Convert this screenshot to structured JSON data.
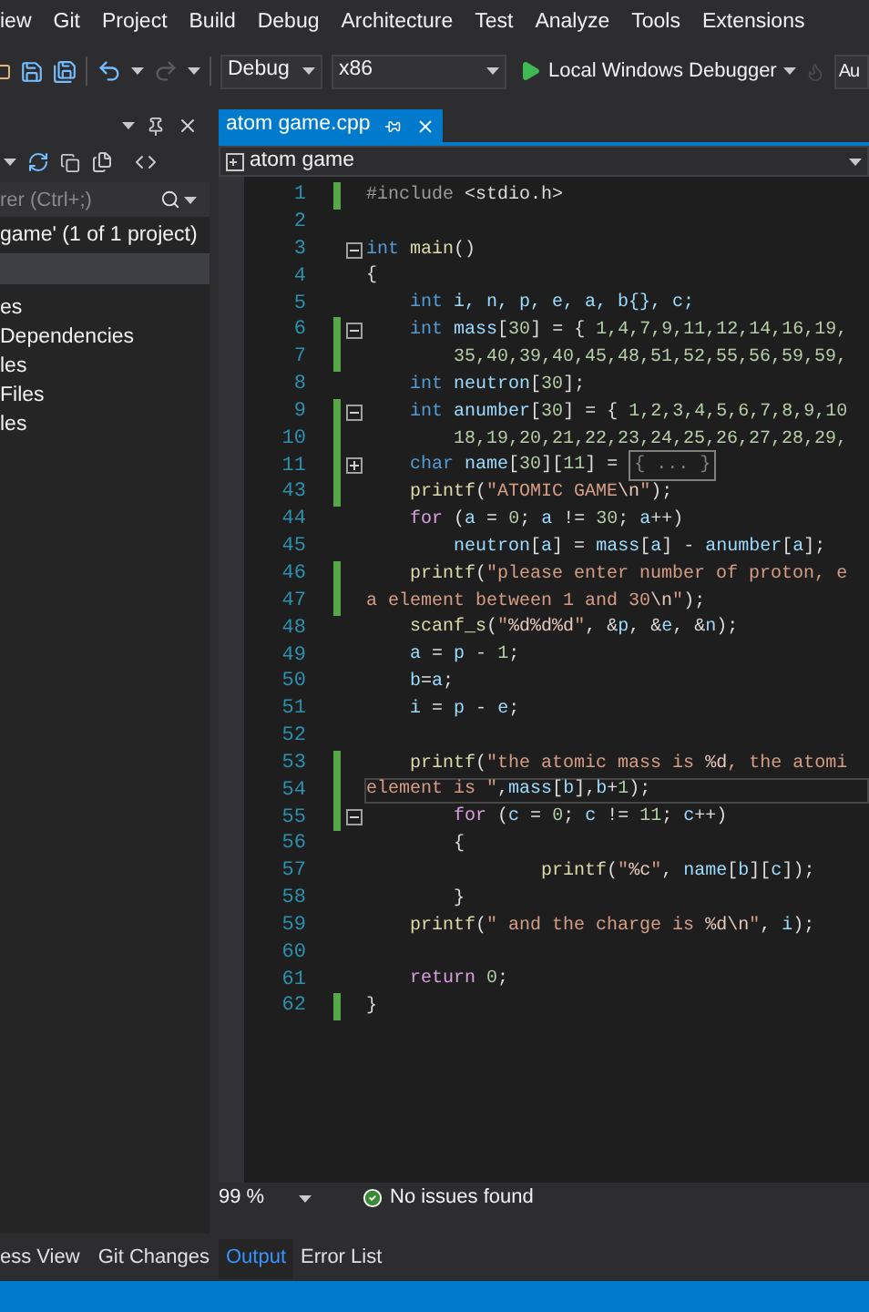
{
  "menu": [
    "iew",
    "Git",
    "Project",
    "Build",
    "Debug",
    "Architecture",
    "Test",
    "Analyze",
    "Tools",
    "Extensions"
  ],
  "toolbar": {
    "configuration": "Debug",
    "platform": "x86",
    "run": "Local Windows Debugger",
    "search": "Au"
  },
  "solution_explorer": {
    "search": {
      "placeholder": "rer (Ctrl+;)"
    },
    "solution": "game' (1 of 1 project)",
    "items": [
      "es",
      "Dependencies",
      "les",
      "Files",
      "les"
    ],
    "bottom_tabs": [
      {
        "label": "ess View",
        "selected": false
      },
      {
        "label": "Git Changes",
        "selected": false
      }
    ]
  },
  "editor": {
    "tabs": [
      {
        "label": "atom game.cpp",
        "selected": true
      }
    ],
    "navigation": "atom game",
    "lines": [
      {
        "number": "1",
        "changed": true,
        "current": false,
        "tokens": [
          {
            "kind": "pre",
            "text": "#include"
          },
          {
            "kind": "plain",
            "text": " <stdio.h>"
          }
        ]
      },
      {
        "number": "2",
        "changed": false,
        "current": false
      },
      {
        "number": "3",
        "changed": false,
        "current": false,
        "collapsed": false,
        "tokens": [
          {
            "kind": "kw",
            "text": "int"
          },
          {
            "kind": "fn",
            "text": " main"
          },
          {
            "kind": "plain",
            "text": "()"
          }
        ]
      },
      {
        "number": "4",
        "changed": false,
        "current": false,
        "tokens": [
          {
            "kind": "plain",
            "text": "{"
          }
        ]
      },
      {
        "number": "5",
        "changed": false,
        "current": false,
        "tokens": [
          {
            "kind": "kw",
            "text": "    int"
          },
          {
            "kind": "var",
            "text": " i, n, p, e, a, b{}, c;"
          }
        ]
      },
      {
        "number": "6",
        "changed": true,
        "current": false,
        "collapsed": false,
        "tokens": [
          {
            "kind": "kw",
            "text": "    int"
          },
          {
            "kind": "var",
            "text": " mass"
          },
          {
            "kind": "plain",
            "text": "["
          },
          {
            "kind": "num",
            "text": "30"
          },
          {
            "kind": "plain",
            "text": "] = { "
          },
          {
            "kind": "num",
            "text": "1,4,7,9,11,12,14,16,19,"
          }
        ]
      },
      {
        "number": "7",
        "changed": true,
        "current": false,
        "tokens": [
          {
            "kind": "num",
            "text": "        35,40,39,40,45,48,51,52,55,56,59,59,"
          }
        ]
      },
      {
        "number": "8",
        "changed": false,
        "current": false,
        "tokens": [
          {
            "kind": "kw",
            "text": "    int"
          },
          {
            "kind": "var",
            "text": " neutron"
          },
          {
            "kind": "plain",
            "text": "["
          },
          {
            "kind": "num",
            "text": "30"
          },
          {
            "kind": "plain",
            "text": "];"
          }
        ]
      },
      {
        "number": "9",
        "changed": true,
        "current": false,
        "collapsed": false,
        "tokens": [
          {
            "kind": "kw",
            "text": "    int"
          },
          {
            "kind": "var",
            "text": " anumber"
          },
          {
            "kind": "plain",
            "text": "["
          },
          {
            "kind": "num",
            "text": "30"
          },
          {
            "kind": "plain",
            "text": "] = { "
          },
          {
            "kind": "num",
            "text": "1,2,3,4,5,6,7,8,9,10"
          }
        ]
      },
      {
        "number": "10",
        "changed": true,
        "current": false,
        "tokens": [
          {
            "kind": "num",
            "text": "        18,19,20,21,22,23,24,25,26,27,28,29,"
          }
        ]
      },
      {
        "number": "11",
        "changed": true,
        "current": false,
        "collapsed": true,
        "tokens": [
          {
            "kind": "kw",
            "text": "    char"
          },
          {
            "kind": "var",
            "text": " name"
          },
          {
            "kind": "plain",
            "text": "["
          },
          {
            "kind": "num",
            "text": "30"
          },
          {
            "kind": "plain",
            "text": "]["
          },
          {
            "kind": "num",
            "text": "11"
          },
          {
            "kind": "plain",
            "text": "] = "
          },
          {
            "kind": "collapsed",
            "text": "{ ... }"
          }
        ]
      },
      {
        "number": "43",
        "changed": true,
        "current": false,
        "tokens": [
          {
            "kind": "fn",
            "text": "    printf"
          },
          {
            "kind": "plain",
            "text": "("
          },
          {
            "kind": "str",
            "text": "\"ATOMIC GAME"
          },
          {
            "kind": "esc",
            "text": "\\n"
          },
          {
            "kind": "str",
            "text": "\""
          },
          {
            "kind": "plain",
            "text": ");"
          }
        ]
      },
      {
        "number": "44",
        "changed": false,
        "current": false,
        "tokens": [
          {
            "kind": "ctl",
            "text": "    for"
          },
          {
            "kind": "plain",
            "text": " ("
          },
          {
            "kind": "var",
            "text": "a"
          },
          {
            "kind": "plain",
            "text": " = "
          },
          {
            "kind": "num",
            "text": "0"
          },
          {
            "kind": "plain",
            "text": "; "
          },
          {
            "kind": "var",
            "text": "a"
          },
          {
            "kind": "plain",
            "text": " != "
          },
          {
            "kind": "num",
            "text": "30"
          },
          {
            "kind": "plain",
            "text": "; "
          },
          {
            "kind": "var",
            "text": "a"
          },
          {
            "kind": "plain",
            "text": "++)"
          }
        ]
      },
      {
        "number": "45",
        "changed": false,
        "current": false,
        "tokens": [
          {
            "kind": "var",
            "text": "        neutron"
          },
          {
            "kind": "plain",
            "text": "["
          },
          {
            "kind": "var",
            "text": "a"
          },
          {
            "kind": "plain",
            "text": "] = "
          },
          {
            "kind": "var",
            "text": "mass"
          },
          {
            "kind": "plain",
            "text": "["
          },
          {
            "kind": "var",
            "text": "a"
          },
          {
            "kind": "plain",
            "text": "] - "
          },
          {
            "kind": "var",
            "text": "anumber"
          },
          {
            "kind": "plain",
            "text": "["
          },
          {
            "kind": "var",
            "text": "a"
          },
          {
            "kind": "plain",
            "text": "];"
          }
        ]
      },
      {
        "number": "46",
        "changed": true,
        "current": false,
        "tokens": [
          {
            "kind": "fn",
            "text": "    printf"
          },
          {
            "kind": "plain",
            "text": "("
          },
          {
            "kind": "str",
            "text": "\"please enter number of proton, e"
          }
        ]
      },
      {
        "number": "47",
        "changed": true,
        "current": false,
        "tokens": [
          {
            "kind": "str",
            "text": "a element between 1 and 30"
          },
          {
            "kind": "esc",
            "text": "\\n"
          },
          {
            "kind": "str",
            "text": "\""
          },
          {
            "kind": "plain",
            "text": ");"
          }
        ]
      },
      {
        "number": "48",
        "changed": false,
        "current": false,
        "tokens": [
          {
            "kind": "fn",
            "text": "    scanf_s"
          },
          {
            "kind": "plain",
            "text": "("
          },
          {
            "kind": "str",
            "text": "\""
          },
          {
            "kind": "esc",
            "text": "%d%d%d"
          },
          {
            "kind": "str",
            "text": "\""
          },
          {
            "kind": "plain",
            "text": ", &"
          },
          {
            "kind": "var",
            "text": "p"
          },
          {
            "kind": "plain",
            "text": ", &"
          },
          {
            "kind": "var",
            "text": "e"
          },
          {
            "kind": "plain",
            "text": ", &"
          },
          {
            "kind": "var",
            "text": "n"
          },
          {
            "kind": "plain",
            "text": ");"
          }
        ]
      },
      {
        "number": "49",
        "changed": false,
        "current": false,
        "tokens": [
          {
            "kind": "var",
            "text": "    a"
          },
          {
            "kind": "plain",
            "text": " = "
          },
          {
            "kind": "var",
            "text": "p"
          },
          {
            "kind": "plain",
            "text": " - "
          },
          {
            "kind": "num",
            "text": "1"
          },
          {
            "kind": "plain",
            "text": ";"
          }
        ]
      },
      {
        "number": "50",
        "changed": false,
        "current": false,
        "tokens": [
          {
            "kind": "var",
            "text": "    b"
          },
          {
            "kind": "plain",
            "text": "="
          },
          {
            "kind": "var",
            "text": "a"
          },
          {
            "kind": "plain",
            "text": ";"
          }
        ]
      },
      {
        "number": "51",
        "changed": false,
        "current": false,
        "tokens": [
          {
            "kind": "var",
            "text": "    i"
          },
          {
            "kind": "plain",
            "text": " = "
          },
          {
            "kind": "var",
            "text": "p"
          },
          {
            "kind": "plain",
            "text": " - "
          },
          {
            "kind": "var",
            "text": "e"
          },
          {
            "kind": "plain",
            "text": ";"
          }
        ]
      },
      {
        "number": "52",
        "changed": false,
        "current": false
      },
      {
        "number": "53",
        "changed": true,
        "current": false,
        "tokens": [
          {
            "kind": "fn",
            "text": "    printf"
          },
          {
            "kind": "plain",
            "text": "("
          },
          {
            "kind": "str",
            "text": "\"the atomic mass is "
          },
          {
            "kind": "esc",
            "text": "%d"
          },
          {
            "kind": "str",
            "text": ", the atomi"
          }
        ]
      },
      {
        "number": "54",
        "changed": true,
        "current": true,
        "tokens": [
          {
            "kind": "str",
            "text": "element is \""
          },
          {
            "kind": "plain",
            "text": ","
          },
          {
            "kind": "var",
            "text": "mass"
          },
          {
            "kind": "plain",
            "text": "["
          },
          {
            "kind": "var",
            "text": "b"
          },
          {
            "kind": "plain",
            "text": "],"
          },
          {
            "kind": "var",
            "text": "b"
          },
          {
            "kind": "plain",
            "text": "+"
          },
          {
            "kind": "num",
            "text": "1"
          },
          {
            "kind": "plain",
            "text": ");"
          }
        ]
      },
      {
        "number": "55",
        "changed": true,
        "current": false,
        "collapsed": false,
        "tokens": [
          {
            "kind": "ctl",
            "text": "        for"
          },
          {
            "kind": "plain",
            "text": " ("
          },
          {
            "kind": "var",
            "text": "c"
          },
          {
            "kind": "plain",
            "text": " = "
          },
          {
            "kind": "num",
            "text": "0"
          },
          {
            "kind": "plain",
            "text": "; "
          },
          {
            "kind": "var",
            "text": "c"
          },
          {
            "kind": "plain",
            "text": " != "
          },
          {
            "kind": "num",
            "text": "11"
          },
          {
            "kind": "plain",
            "text": "; "
          },
          {
            "kind": "var",
            "text": "c"
          },
          {
            "kind": "plain",
            "text": "++)"
          }
        ]
      },
      {
        "number": "56",
        "changed": false,
        "current": false,
        "tokens": [
          {
            "kind": "plain",
            "text": "        {"
          }
        ]
      },
      {
        "number": "57",
        "changed": false,
        "current": false,
        "tokens": [
          {
            "kind": "fn",
            "text": "                printf"
          },
          {
            "kind": "plain",
            "text": "("
          },
          {
            "kind": "str",
            "text": "\""
          },
          {
            "kind": "esc",
            "text": "%c"
          },
          {
            "kind": "str",
            "text": "\""
          },
          {
            "kind": "plain",
            "text": ", "
          },
          {
            "kind": "var",
            "text": "name"
          },
          {
            "kind": "plain",
            "text": "["
          },
          {
            "kind": "var",
            "text": "b"
          },
          {
            "kind": "plain",
            "text": "]["
          },
          {
            "kind": "var",
            "text": "c"
          },
          {
            "kind": "plain",
            "text": "]);"
          }
        ]
      },
      {
        "number": "58",
        "changed": false,
        "current": false,
        "tokens": [
          {
            "kind": "plain",
            "text": "        }"
          }
        ]
      },
      {
        "number": "59",
        "changed": false,
        "current": false,
        "tokens": [
          {
            "kind": "fn",
            "text": "    printf"
          },
          {
            "kind": "plain",
            "text": "("
          },
          {
            "kind": "str",
            "text": "\" and the charge is "
          },
          {
            "kind": "esc",
            "text": "%d\\n"
          },
          {
            "kind": "str",
            "text": "\""
          },
          {
            "kind": "plain",
            "text": ", "
          },
          {
            "kind": "var",
            "text": "i"
          },
          {
            "kind": "plain",
            "text": ");"
          }
        ]
      },
      {
        "number": "60",
        "changed": false,
        "current": false
      },
      {
        "number": "61",
        "changed": false,
        "current": false,
        "tokens": [
          {
            "kind": "ctl",
            "text": "    return"
          },
          {
            "kind": "num",
            "text": " 0"
          },
          {
            "kind": "plain",
            "text": ";"
          }
        ]
      },
      {
        "number": "62",
        "changed": true,
        "current": false,
        "tokens": [
          {
            "kind": "plain",
            "text": "}"
          }
        ]
      }
    ],
    "zoom": "99 %",
    "issues": "No issues found"
  },
  "bottom_tabs": [
    {
      "label": "Output",
      "selected": true
    },
    {
      "label": "Error List",
      "selected": false
    }
  ]
}
